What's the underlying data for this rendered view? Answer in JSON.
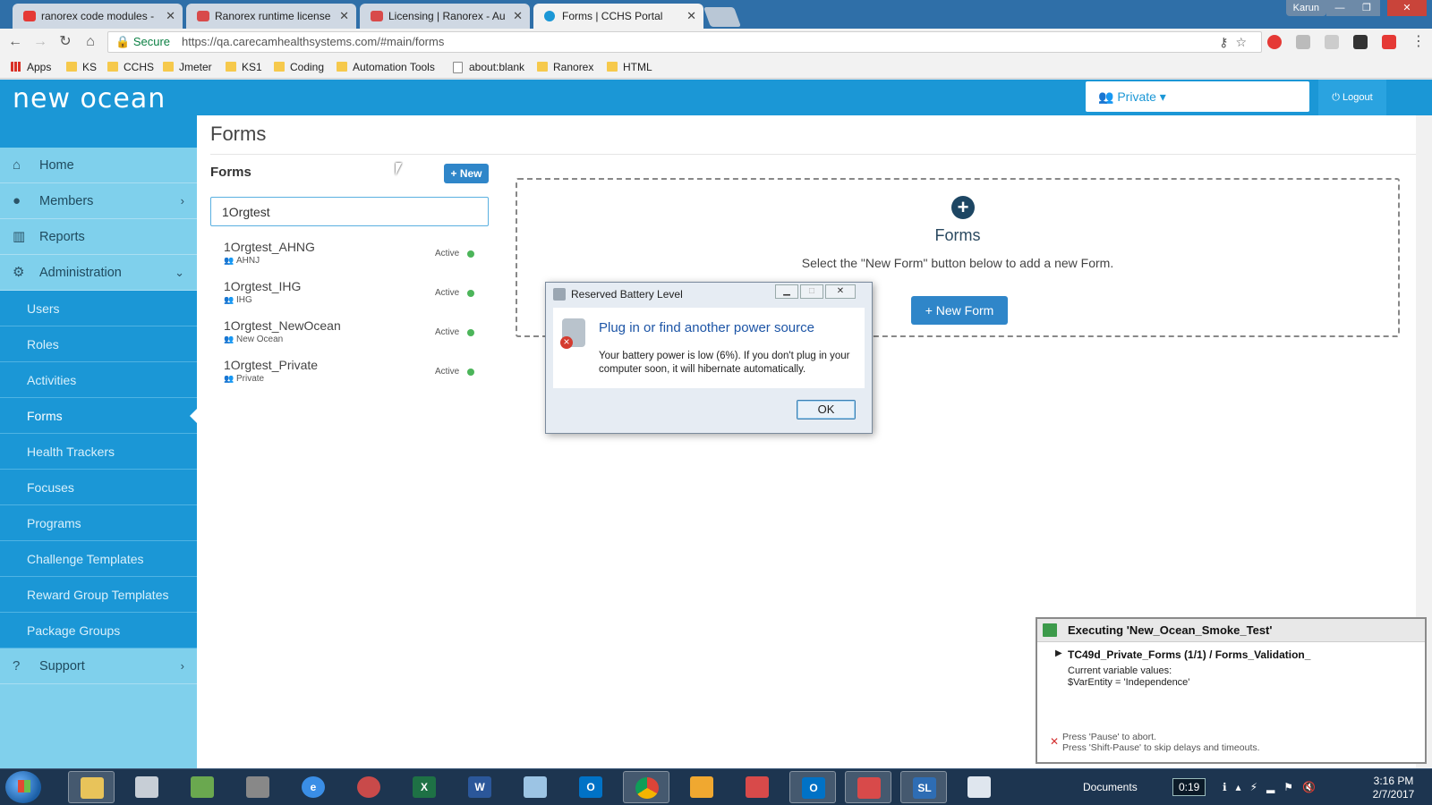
{
  "browser": {
    "tabs": [
      {
        "label": "ranorex code modules -",
        "color": "#e53935"
      },
      {
        "label": "Ranorex runtime license",
        "color": "#d84a4a"
      },
      {
        "label": "Licensing | Ranorex - Au",
        "color": "#d84a4a"
      },
      {
        "label": "Forms | CCHS Portal",
        "color": "#1b97d6"
      }
    ],
    "user": "Karun",
    "secure_label": "Secure",
    "url": "https://qa.carecamhealthsystems.com/#main/forms",
    "bookmarks": [
      "Apps",
      "KS",
      "CCHS",
      "Jmeter",
      "KS1",
      "Coding",
      "Automation Tools",
      "about:blank",
      "Ranorex",
      "HTML"
    ]
  },
  "app": {
    "logo": "new ocean",
    "org_selector": "Private ▾",
    "logout": "Logout",
    "sidebar": {
      "top_items": [
        {
          "label": "Home",
          "icon": "home-icon"
        },
        {
          "label": "Members",
          "icon": "user-icon"
        },
        {
          "label": "Reports",
          "icon": "bar-chart-icon"
        },
        {
          "label": "Administration",
          "icon": "gear-icon"
        }
      ],
      "admin_items": [
        "Users",
        "Roles",
        "Activities",
        "Forms",
        "Health Trackers",
        "Focuses",
        "Programs",
        "Challenge Templates",
        "Reward Group Templates",
        "Package Groups"
      ],
      "support": "Support"
    },
    "main": {
      "page_title": "Forms",
      "list_title": "Forms",
      "new_button": "+ New",
      "search_value": "1Orgtest",
      "forms": [
        {
          "name": "1Orgtest_AHNG",
          "org": "AHNJ",
          "status": "Active"
        },
        {
          "name": "1Orgtest_IHG",
          "org": "IHG",
          "status": "Active"
        },
        {
          "name": "1Orgtest_NewOcean",
          "org": "New Ocean",
          "status": "Active"
        },
        {
          "name": "1Orgtest_Private",
          "org": "Private",
          "status": "Active"
        }
      ],
      "empty_title": "Forms",
      "empty_text": "Select the \"New Form\" button below to add a new Form.",
      "new_form_button": "+ New Form"
    }
  },
  "dialog": {
    "title": "Reserved Battery Level",
    "heading": "Plug in or find another power source",
    "message": "Your battery power is low (6%). If you don't plug in your computer soon, it will hibernate automatically.",
    "ok": "OK"
  },
  "ranorex": {
    "title": "Executing 'New_Ocean_Smoke_Test'",
    "testcase": "TC49d_Private_Forms (1/1) / Forms_Validation_",
    "vars_label": "Current variable values:",
    "var_value": "$VarEntity = 'Independence'",
    "hint_pause": "Press 'Pause' to abort.",
    "hint_skip": "Press 'Shift-Pause' to skip delays and timeouts."
  },
  "taskbar": {
    "documents": "Documents",
    "timer": "0:19",
    "time": "3:16 PM",
    "date": "2/7/2017"
  }
}
